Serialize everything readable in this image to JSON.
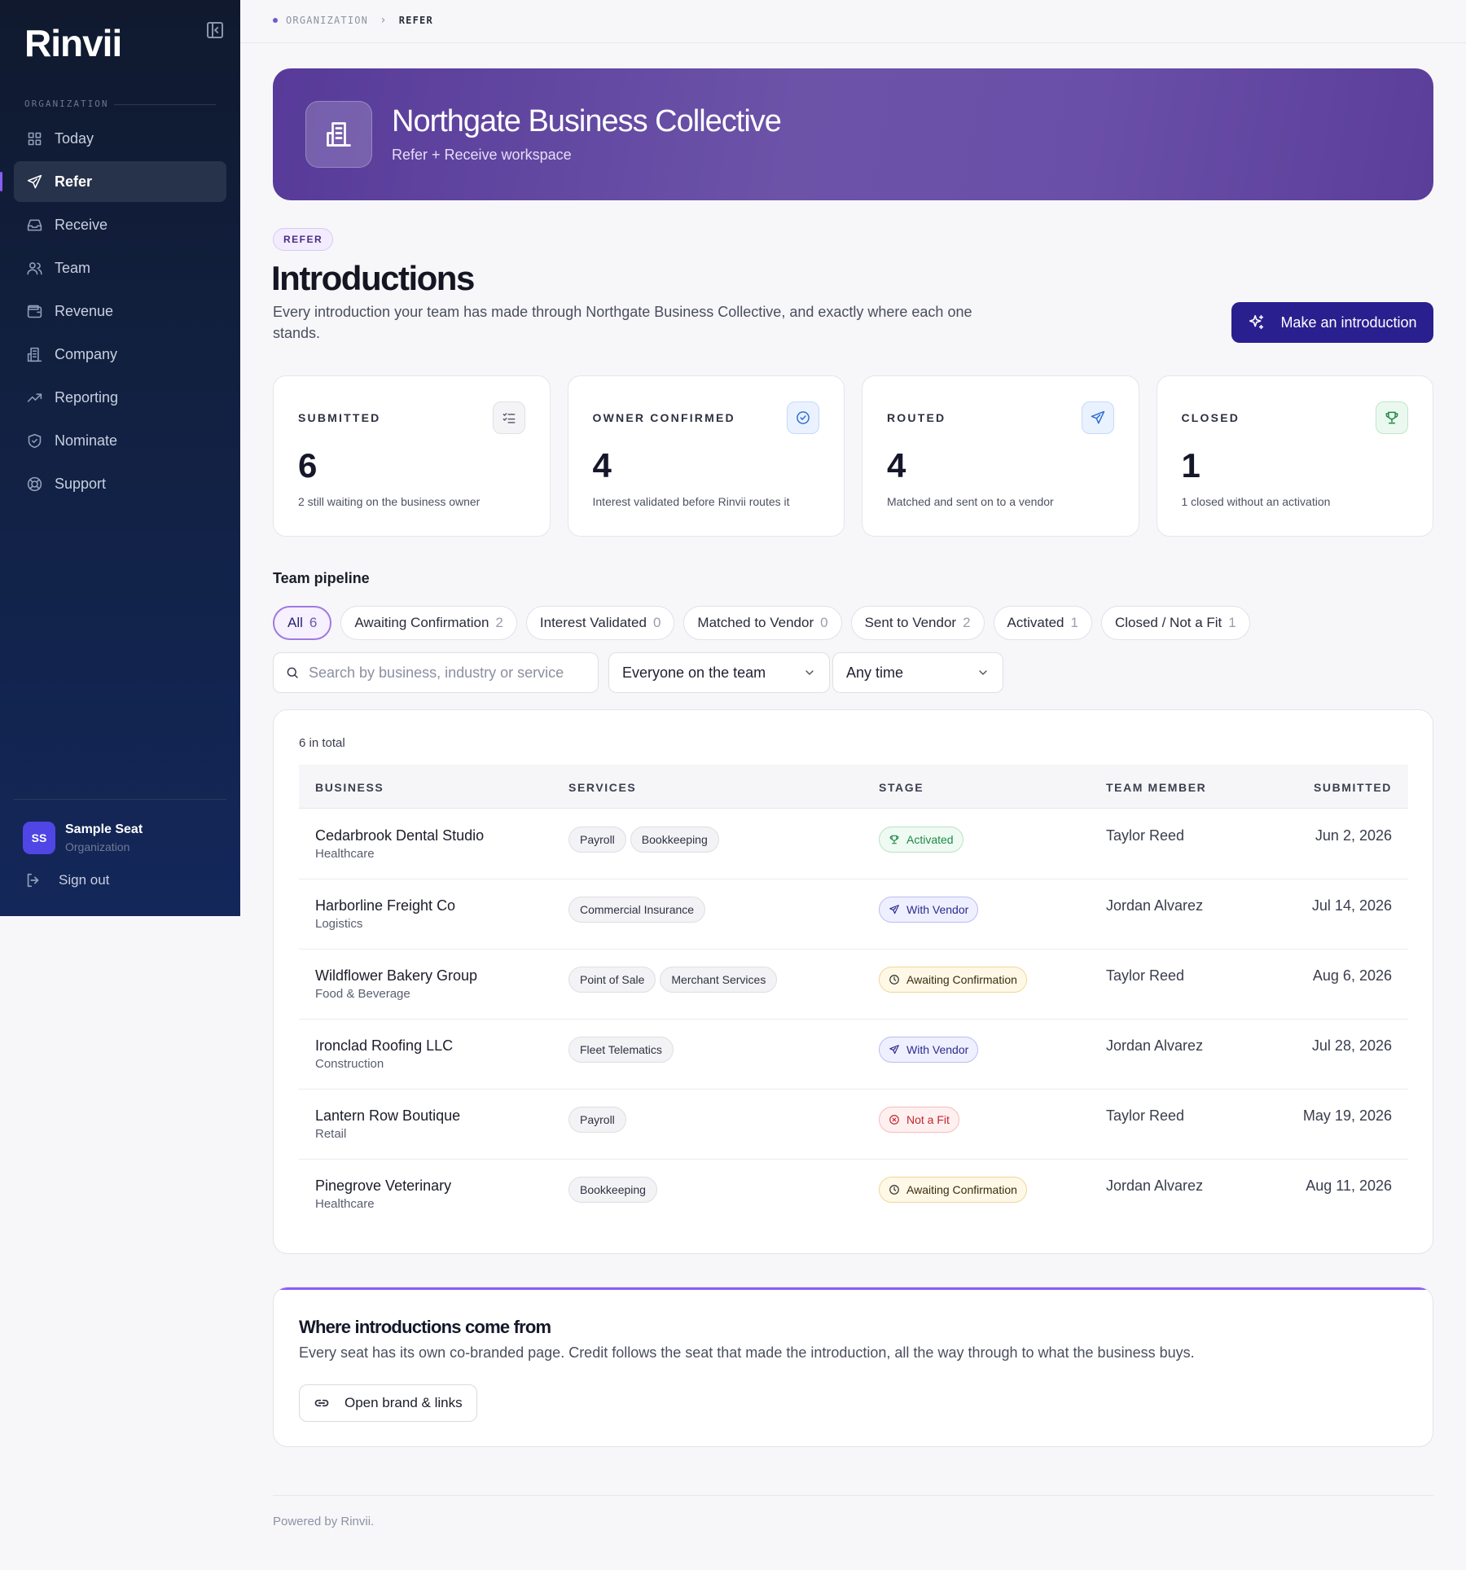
{
  "sidebar": {
    "logo": "Rinvii",
    "section_label": "ORGANIZATION",
    "items": [
      {
        "label": "Today",
        "icon": "grid-icon"
      },
      {
        "label": "Refer",
        "icon": "send-icon",
        "active": true
      },
      {
        "label": "Receive",
        "icon": "inbox-icon"
      },
      {
        "label": "Team",
        "icon": "users-icon"
      },
      {
        "label": "Revenue",
        "icon": "wallet-icon"
      },
      {
        "label": "Company",
        "icon": "building-icon"
      },
      {
        "label": "Reporting",
        "icon": "trend-icon"
      },
      {
        "label": "Nominate",
        "icon": "badge-icon"
      },
      {
        "label": "Support",
        "icon": "lifebuoy-icon"
      }
    ],
    "user": {
      "initials": "SS",
      "name": "Sample Seat",
      "role": "Organization"
    },
    "signout_label": "Sign out"
  },
  "breadcrumb": {
    "parent": "ORGANIZATION",
    "current": "REFER"
  },
  "hero": {
    "title": "Northgate Business Collective",
    "subtitle": "Refer + Receive workspace"
  },
  "header": {
    "tag": "REFER",
    "title": "Introductions",
    "description": "Every introduction your team has made through Northgate Business Collective, and exactly where each one stands.",
    "primary_button": "Make an introduction"
  },
  "stats": [
    {
      "label": "SUBMITTED",
      "value": "6",
      "note": "2 still waiting on the business owner",
      "icon": "checklist-icon",
      "color": "#6b6f80"
    },
    {
      "label": "OWNER CONFIRMED",
      "value": "4",
      "note": "Interest validated before Rinvii routes it",
      "icon": "check-circle-icon",
      "color": "#2f6fd6"
    },
    {
      "label": "ROUTED",
      "value": "4",
      "note": "Matched and sent on to a vendor",
      "icon": "send-icon",
      "color": "#2f6fd6"
    },
    {
      "label": "CLOSED",
      "value": "1",
      "note": "1 closed without an activation",
      "icon": "trophy-icon",
      "color": "#1d8a47"
    }
  ],
  "pipeline": {
    "title": "Team pipeline",
    "chips": [
      {
        "label": "All",
        "count": "6",
        "active": true
      },
      {
        "label": "Awaiting Confirmation",
        "count": "2"
      },
      {
        "label": "Interest Validated",
        "count": "0"
      },
      {
        "label": "Matched to Vendor",
        "count": "0"
      },
      {
        "label": "Sent to Vendor",
        "count": "2"
      },
      {
        "label": "Activated",
        "count": "1"
      },
      {
        "label": "Closed / Not a Fit",
        "count": "1"
      }
    ]
  },
  "filters": {
    "search_placeholder": "Search by business, industry or service",
    "member_select": "Everyone on the team",
    "time_select": "Any time"
  },
  "table": {
    "total": "6 in total",
    "columns": [
      "BUSINESS",
      "SERVICES",
      "STAGE",
      "TEAM MEMBER",
      "SUBMITTED"
    ],
    "rows": [
      {
        "business": "Cedarbrook Dental Studio",
        "industry": "Healthcare",
        "services": [
          "Payroll",
          "Bookkeeping"
        ],
        "stage": "Activated",
        "stage_color": "green",
        "member": "Taylor Reed",
        "date": "Jun 2, 2026"
      },
      {
        "business": "Harborline Freight Co",
        "industry": "Logistics",
        "services": [
          "Commercial Insurance"
        ],
        "stage": "With Vendor",
        "stage_color": "blue",
        "member": "Jordan Alvarez",
        "date": "Jul 14, 2026"
      },
      {
        "business": "Wildflower Bakery Group",
        "industry": "Food & Beverage",
        "services": [
          "Point of Sale",
          "Merchant Services"
        ],
        "stage": "Awaiting Confirmation",
        "stage_color": "amber",
        "member": "Taylor Reed",
        "date": "Aug 6, 2026"
      },
      {
        "business": "Ironclad Roofing LLC",
        "industry": "Construction",
        "services": [
          "Fleet Telematics"
        ],
        "stage": "With Vendor",
        "stage_color": "blue",
        "member": "Jordan Alvarez",
        "date": "Jul 28, 2026"
      },
      {
        "business": "Lantern Row Boutique",
        "industry": "Retail",
        "services": [
          "Payroll"
        ],
        "stage": "Not a Fit",
        "stage_color": "red",
        "member": "Taylor Reed",
        "date": "May 19, 2026"
      },
      {
        "business": "Pinegrove Veterinary",
        "industry": "Healthcare",
        "services": [
          "Bookkeeping"
        ],
        "stage": "Awaiting Confirmation",
        "stage_color": "amber",
        "member": "Jordan Alvarez",
        "date": "Aug 11, 2026"
      }
    ]
  },
  "info": {
    "title": "Where introductions come from",
    "text": "Every seat has its own co-branded page. Credit follows the seat that made the introduction, all the way through to what the business buys.",
    "button": "Open brand & links"
  },
  "footer": "Powered by Rinvii."
}
